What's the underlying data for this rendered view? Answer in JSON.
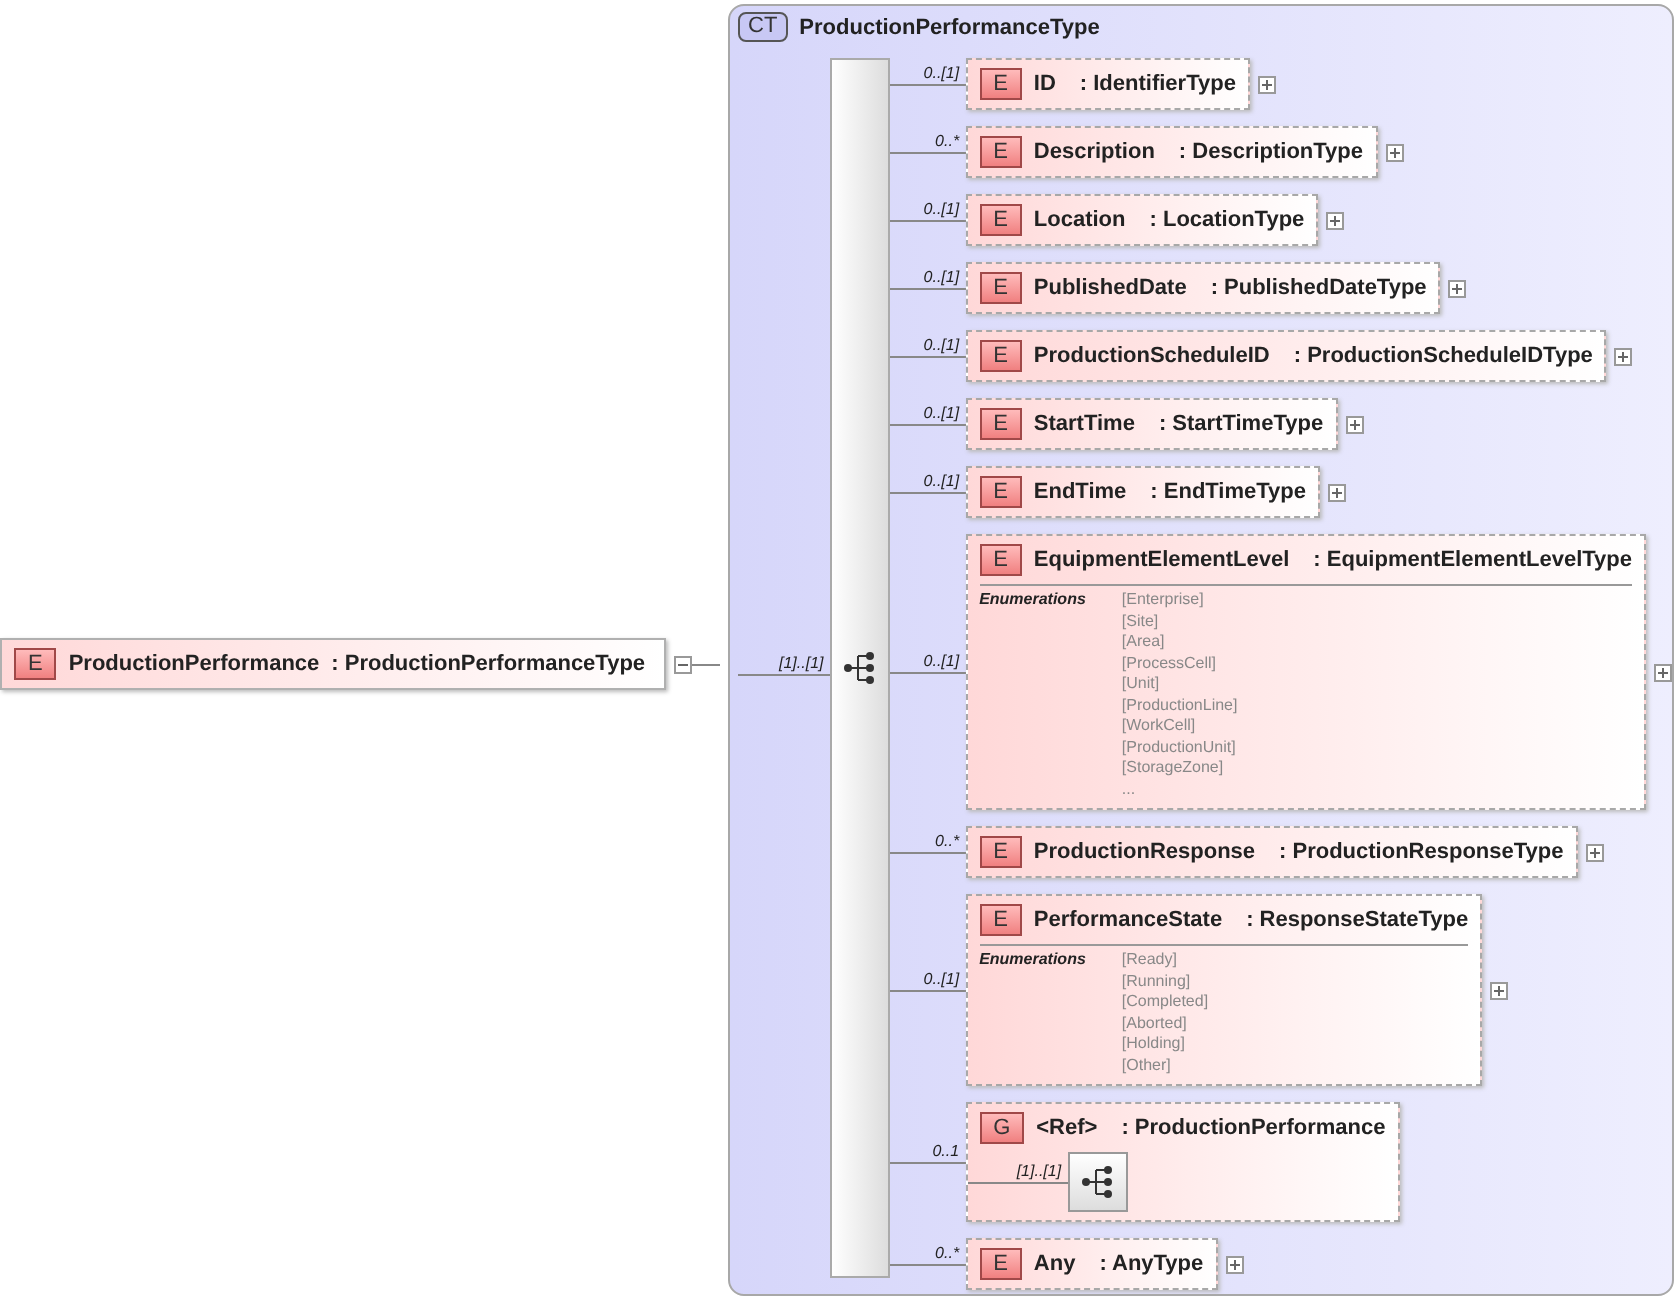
{
  "root": {
    "badge": "E",
    "name": "ProductionPerformance",
    "type": ": ProductionPerformanceType",
    "expanded": true,
    "cardinality": "[1]..[1]"
  },
  "complex_type": {
    "badge": "CT",
    "name": "ProductionPerformanceType"
  },
  "items": [
    {
      "kind": "element",
      "badge": "E",
      "cardinality": "0..[1]",
      "name": "ID",
      "type": ": IdentifierType",
      "expanded": false
    },
    {
      "kind": "element",
      "badge": "E",
      "cardinality": "0..*",
      "name": "Description",
      "type": ": DescriptionType",
      "expanded": false
    },
    {
      "kind": "element",
      "badge": "E",
      "cardinality": "0..[1]",
      "name": "Location",
      "type": ": LocationType",
      "expanded": false
    },
    {
      "kind": "element",
      "badge": "E",
      "cardinality": "0..[1]",
      "name": "PublishedDate",
      "type": ": PublishedDateType",
      "expanded": false
    },
    {
      "kind": "element",
      "badge": "E",
      "cardinality": "0..[1]",
      "name": "ProductionScheduleID",
      "type": ": ProductionScheduleIDType",
      "expanded": false
    },
    {
      "kind": "element",
      "badge": "E",
      "cardinality": "0..[1]",
      "name": "StartTime",
      "type": ": StartTimeType",
      "expanded": false
    },
    {
      "kind": "element",
      "badge": "E",
      "cardinality": "0..[1]",
      "name": "EndTime",
      "type": ": EndTimeType",
      "expanded": false
    },
    {
      "kind": "element",
      "badge": "E",
      "cardinality": "0..[1]",
      "name": "EquipmentElementLevel",
      "type": ": EquipmentElementLevelType",
      "expanded": false,
      "enumerations_label": "Enumerations",
      "enumerations": [
        "[Enterprise]",
        "[Site]",
        "[Area]",
        "[ProcessCell]",
        "[Unit]",
        "[ProductionLine]",
        "[WorkCell]",
        "[ProductionUnit]",
        "[StorageZone]",
        "..."
      ]
    },
    {
      "kind": "element",
      "badge": "E",
      "cardinality": "0..*",
      "name": "ProductionResponse",
      "type": ": ProductionResponseType",
      "expanded": false
    },
    {
      "kind": "element",
      "badge": "E",
      "cardinality": "0..[1]",
      "name": "PerformanceState",
      "type": ": ResponseStateType",
      "expanded": false,
      "enumerations_label": "Enumerations",
      "enumerations": [
        "[Ready]",
        "[Running]",
        "[Completed]",
        "[Aborted]",
        "[Holding]",
        "[Other]"
      ]
    },
    {
      "kind": "group",
      "badge": "G",
      "cardinality": "0..1",
      "name": "<Ref>",
      "type": ": ProductionPerformance",
      "inner_cardinality": "[1]..[1]"
    },
    {
      "kind": "element",
      "badge": "E",
      "cardinality": "0..*",
      "name": "Any",
      "type": ": AnyType",
      "expanded": false
    }
  ]
}
